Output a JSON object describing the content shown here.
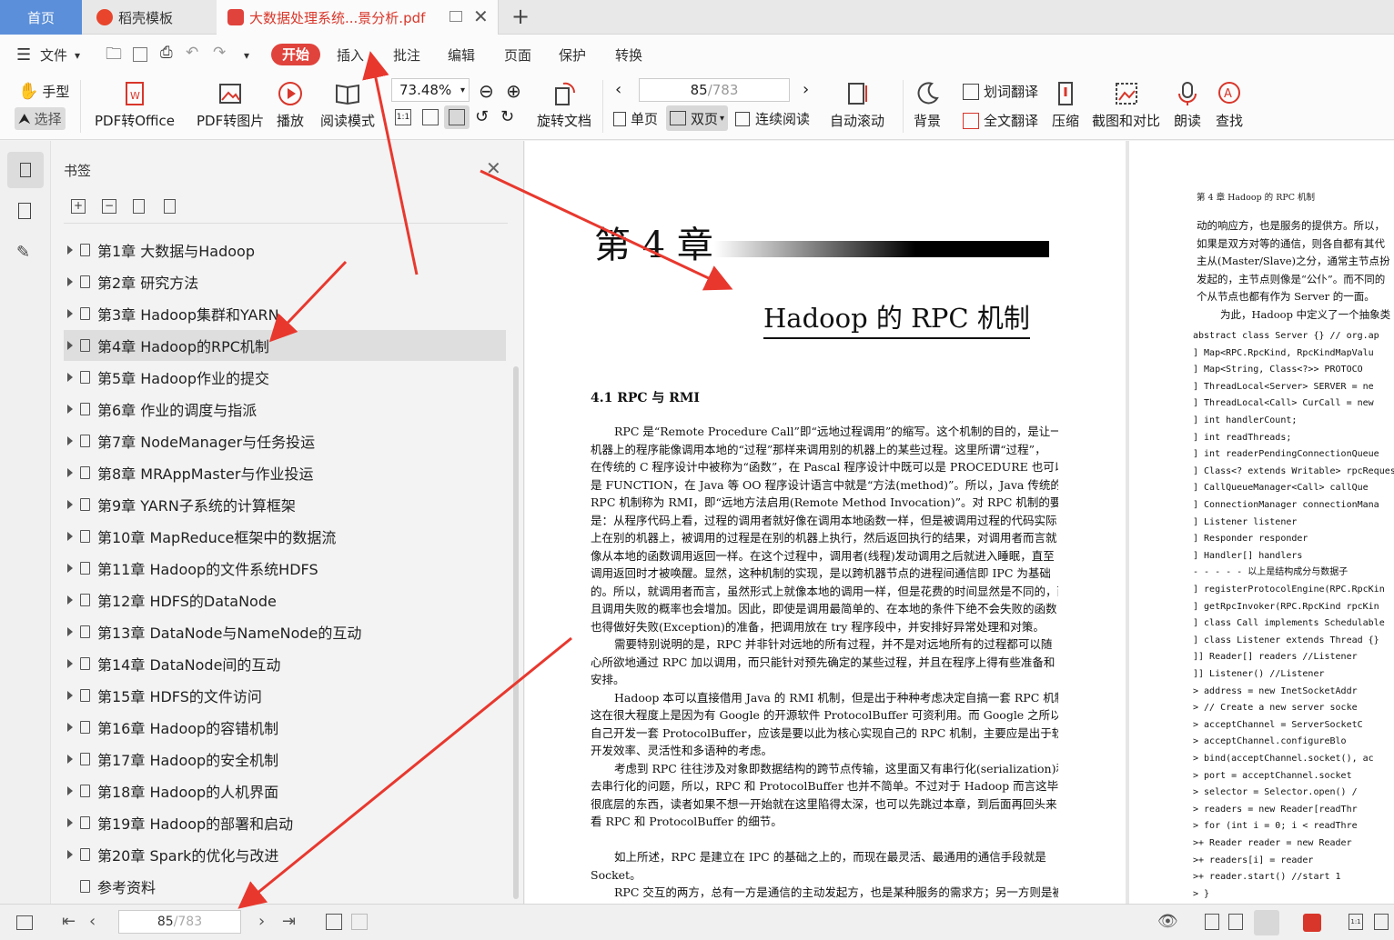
{
  "tabs": {
    "home": "首页",
    "template": "稻壳模板",
    "pdf": "大数据处理系统...景分析.pdf"
  },
  "menu": {
    "file": "文件",
    "items": [
      "开始",
      "插入",
      "批注",
      "编辑",
      "页面",
      "保护",
      "转换"
    ]
  },
  "toolbar": {
    "hand": "手型",
    "select": "选择",
    "pdf_to_office": "PDF转Office",
    "pdf_to_image": "PDF转图片",
    "play": "播放",
    "read_mode": "阅读模式",
    "zoom": "73.48%",
    "rotate": "旋转文档",
    "page_current": "85",
    "page_total": "/783",
    "single": "单页",
    "double": "双页",
    "continuous": "连续阅读",
    "auto_scroll": "自动滚动",
    "background": "背景",
    "word_translate": "划词翻译",
    "full_translate": "全文翻译",
    "compress": "压缩",
    "screenshot": "截图和对比",
    "read_aloud": "朗读",
    "search": "查找"
  },
  "bookmarks": {
    "title": "书签",
    "items": [
      "第1章 大数据与Hadoop",
      "第2章 研究方法",
      "第3章 Hadoop集群和YARN",
      "第4章 Hadoop的RPC机制",
      "第5章 Hadoop作业的提交",
      "第6章 作业的调度与指派",
      "第7章 NodeManager与任务投运",
      "第8章 MRAppMaster与作业投运",
      "第9章 YARN子系统的计算框架",
      "第10章 MapReduce框架中的数据流",
      "第11章 Hadoop的文件系统HDFS",
      "第12章 HDFS的DataNode",
      "第13章 DataNode与NameNode的互动",
      "第14章 DataNode间的互动",
      "第15章 HDFS的文件访问",
      "第16章 Hadoop的容错机制",
      "第17章 Hadoop的安全机制",
      "第18章 Hadoop的人机界面",
      "第19章 Hadoop的部署和启动",
      "第20章 Spark的优化与改进",
      "参考资料"
    ],
    "selected_index": 3
  },
  "page_left": {
    "chapter": "第 4 章",
    "title": "Hadoop 的 RPC 机制",
    "section": "4.1 RPC 与 RMI",
    "lines": [
      "RPC 是“Remote Procedure Call”即“远地过程调用”的缩写。这个机制的目的，是让一台",
      "机器上的程序能像调用本地的“过程”那样来调用别的机器上的某些过程。这里所谓“过程”，",
      "在传统的 C 程序设计中被称为“函数”，在 Pascal 程序设计中既可以是 PROCEDURE 也可以",
      "是 FUNCTION，在 Java 等 OO 程序设计语言中就是“方法(method)”。所以，Java 传统的",
      "RPC 机制称为 RMI，即“远地方法启用(Remote Method Invocation)”。对 RPC 机制的要求",
      "是：从程序代码上看，过程的调用者就好像在调用本地函数一样，但是被调用过程的代码实际",
      "上在别的机器上，被调用的过程是在别的机器上执行，然后返回执行的结果，对调用者而言就",
      "像从本地的函数调用返回一样。在这个过程中，调用者(线程)发动调用之后就进入睡眠，直至",
      "调用返回时才被唤醒。显然，这种机制的实现，是以跨机器节点的进程间通信即 IPC 为基础",
      "的。所以，就调用者而言，虽然形式上就像本地的调用一样，但是花费的时间显然是不同的，而",
      "且调用失败的概率也会增加。因此，即使是调用最简单的、在本地的条件下绝不会失败的函数",
      "也得做好失败(Exception)的准备，把调用放在 try 程序段中，并安排好异常处理和对策。",
      "需要特别说明的是，RPC 并非针对远地的所有过程，并不是对远地所有的过程都可以随",
      "心所欲地通过 RPC 加以调用，而只能针对预先确定的某些过程，并且在程序上得有些准备和",
      "安排。",
      "Hadoop 本可以直接借用 Java 的 RMI 机制，但是出于种种考虑决定自搞一套 RPC 机制，",
      "这在很大程度上是因为有 Google 的开源软件 ProtocolBuffer 可资利用。而 Google 之所以要",
      "自己开发一套 ProtocolBuffer，应该是要以此为核心实现自己的 RPC 机制，主要应是出于软件",
      "开发效率、灵活性和多语种的考虑。",
      "考虑到 RPC 往往涉及对象即数据结构的跨节点传输，这里面又有串行化(serialization)和",
      "去串行化的问题，所以，RPC 和 ProtocolBuffer 也并不简单。不过对于 Hadoop 而言这毕竟是",
      "很底层的东西，读者如果不想一开始就在这里陷得太深，也可以先跳过本章，到后面再回头来",
      "看 RPC 和 ProtocolBuffer 的细节。",
      "",
      "如上所述，RPC 是建立在 IPC 的基础之上的，而现在最灵活、最通用的通信手段就是",
      "Socket。",
      "RPC 交互的两方，总有一方是通信的主动发起方，也是某种服务的需求方；另一方则是被"
    ]
  },
  "page_right": {
    "header": "第 4 章   Hadoop 的 RPC 机制",
    "lines": [
      "动的响应方，也是服务的提供方。所以，",
      "如果是双方对等的通信，则各自都有其代",
      "主从(Master/Slave)之分，通常主节点扮",
      "发起的，主节点则像是“公仆”。而不同的",
      "个从节点也都有作为 Server 的一面。",
      "为此，Hadoop 中定义了一个抽象类"
    ],
    "code": [
      "abstract class Server {}   // org.ap",
      "] Map<RPC.RpcKind, RpcKindMapValu",
      "] Map<String, Class<?>> PROTOCO",
      "] ThreadLocal<Server> SERVER = ne",
      "] ThreadLocal<Call> CurCall = new",
      "] int handlerCount;",
      "] int readThreads;",
      "] int readerPendingConnectionQueue",
      "] Class<? extends Writable> rpcReques",
      "] CallQueueManager<Call> callQue",
      "] ConnectionManager connectionMana",
      "] Listener listener",
      "] Responder responder",
      "] Handler[] handlers",
      "- - - - -  以上是结构成分与数据子",
      "] registerProtocolEngine(RPC.RpcKin",
      "] getRpcInvoker(RPC.RpcKind rpcKin",
      "] class Call implements Schedulable",
      "] class Listener extends Thread {}",
      "]] Reader[] readers      //Listener",
      "]] Listener()           //Listener",
      "  > address = new InetSocketAddr",
      "  > // Create a new server socke",
      "  > acceptChannel = ServerSocketC",
      "  > acceptChannel.configureBlo",
      "  > bind(acceptChannel.socket(), ac",
      "  > port = acceptChannel.socket",
      "  > selector = Selector.open()   /",
      "  > readers = new Reader[readThr",
      "  > for (int i = 0; i < readThre",
      "  >+ Reader reader = new Reader",
      "  >+ readers[i] = reader",
      "  >+ reader.start()   //start 1",
      "  > }"
    ]
  },
  "status": {
    "page_current": "85",
    "page_total": "/783"
  },
  "colors": {
    "accent": "#e0433c",
    "arrow": "#e8382e",
    "home_tab": "#5b8fd9"
  }
}
